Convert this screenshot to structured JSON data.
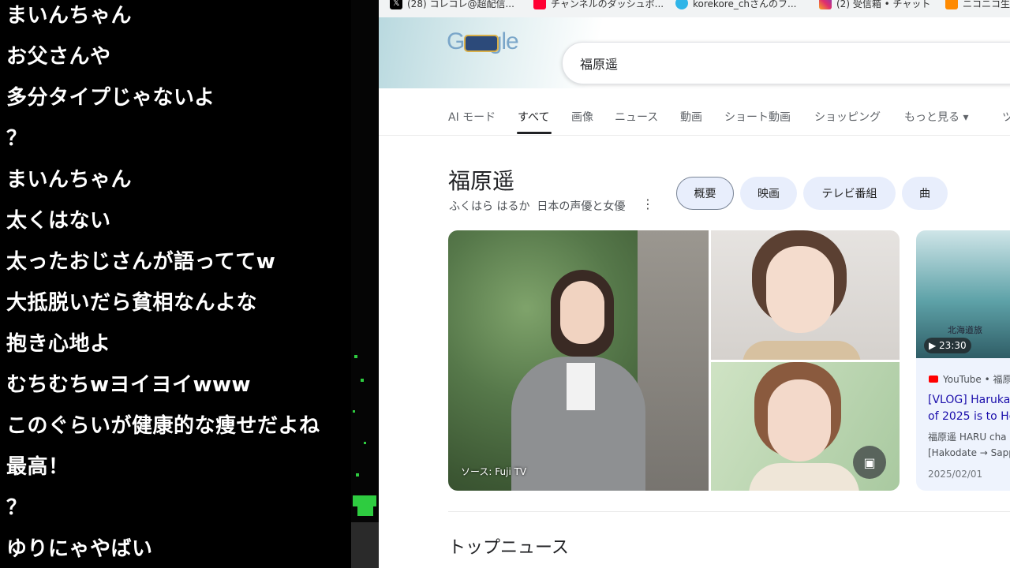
{
  "chat": {
    "messages": [
      "まいんちゃん",
      "お父さんや",
      "多分タイプじゃないよ",
      "？",
      "まいんちゃん",
      "太くはない",
      "太ったおじさんが語っててw",
      "大抵脱いだら貧相なんよな",
      "抱き心地よ",
      "むちむちwヨイヨイwww",
      "このぐらいが健康的な痩せだよね",
      "最高！",
      "？",
      "ゆりにゃやばい"
    ]
  },
  "bookmarks": [
    {
      "label": "(28) コレコレ@超配信...",
      "icon": "x-icon",
      "color": "#000000"
    },
    {
      "label": "チャンネルのダッシュボ...",
      "icon": "youtube-studio-icon",
      "color": "#ff0033"
    },
    {
      "label": "korekore_chさんのフ...",
      "icon": "twitcasting-icon",
      "color": "#2fb5e8"
    },
    {
      "label": "(2) 受信箱 • チャット",
      "icon": "instagram-icon",
      "color": "#e1306c"
    },
    {
      "label": "ニコニコ生...",
      "icon": "niconico-icon",
      "color": "#ff8a00"
    }
  ],
  "google": {
    "logo": "Google",
    "query": "福原遥"
  },
  "tabs": [
    "AI モード",
    "すべて",
    "画像",
    "ニュース",
    "動画",
    "ショート動画",
    "ショッピング",
    "もっと見る ▾",
    "ツ"
  ],
  "active_tab": "すべて",
  "knowledge_panel": {
    "title": "福原遥",
    "reading": "ふくはら はるか",
    "description": "日本の声優と女優",
    "chips": [
      "概要",
      "映画",
      "テレビ番組",
      "曲"
    ],
    "image_source": "ソース: Fuji TV"
  },
  "video": {
    "duration": "▶ 23:30",
    "thumb_text": "北海道旅",
    "source": "YouTube • 福原",
    "title_line1": "[VLOG] Haruka",
    "title_line2": "of 2025 is to Ho",
    "desc_line1": "福原遥 HARU cha",
    "desc_line2": "[Hakodate → Sapp",
    "date": "2025/02/01"
  },
  "section_heading": "トップニュース",
  "colors": {
    "chat_bg": "#000000",
    "chat_text": "#ffffff",
    "chip_bg": "#e8eefc",
    "link": "#1a0dab"
  }
}
